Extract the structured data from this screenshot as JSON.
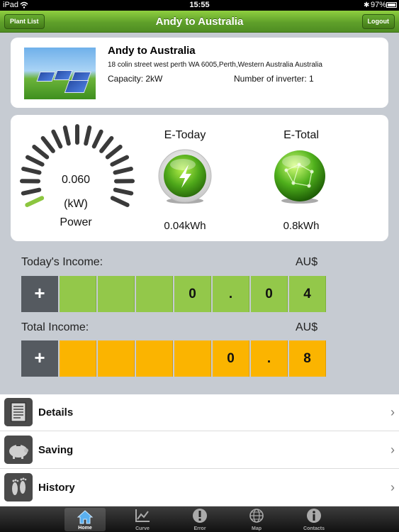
{
  "status_bar": {
    "carrier": "iPad",
    "time": "15:55",
    "battery": "97%"
  },
  "nav": {
    "title": "Andy to Australia",
    "left_button": "Plant List",
    "right_button": "Logout"
  },
  "plant": {
    "name": "Andy to Australia",
    "address": "18 colin street west perth WA 6005,Perth,Western Australia Australia",
    "capacity": "Capacity: 2kW",
    "inverters": "Number of inverter: 1"
  },
  "power": {
    "value": "0.060",
    "unit": "(kW)",
    "label": "Power",
    "gauge_level": 0.03,
    "e_today_label": "E-Today",
    "e_today_value": "0.04kWh",
    "e_total_label": "E-Total",
    "e_total_value": "0.8kWh"
  },
  "income": {
    "today_label": "Today's Income:",
    "today_currency": "AU$",
    "today_digits": [
      "",
      "",
      "",
      "0",
      ".",
      "0",
      "4"
    ],
    "total_label": "Total Income:",
    "total_currency": "AU$",
    "total_digits": [
      "",
      "",
      "",
      "",
      "0",
      ".",
      "8"
    ],
    "plus": "+"
  },
  "menu": [
    {
      "label": "Details",
      "icon": "document-icon"
    },
    {
      "label": "Saving",
      "icon": "piggy-bank-icon"
    },
    {
      "label": "History",
      "icon": "footprints-icon"
    }
  ],
  "tabs": [
    {
      "label": "Home",
      "icon": "home-icon",
      "active": true
    },
    {
      "label": "Curve",
      "icon": "chart-icon",
      "active": false
    },
    {
      "label": "Error",
      "icon": "error-icon",
      "active": false
    },
    {
      "label": "Map",
      "icon": "globe-icon",
      "active": false
    },
    {
      "label": "Contacts",
      "icon": "info-icon",
      "active": false
    }
  ],
  "colors": {
    "nav_green": "#5fa02a",
    "today_digit": "#93c84a",
    "total_digit": "#fbb400",
    "gauge_active": "#8cc63f",
    "gauge_inactive": "#3a3a3a"
  }
}
